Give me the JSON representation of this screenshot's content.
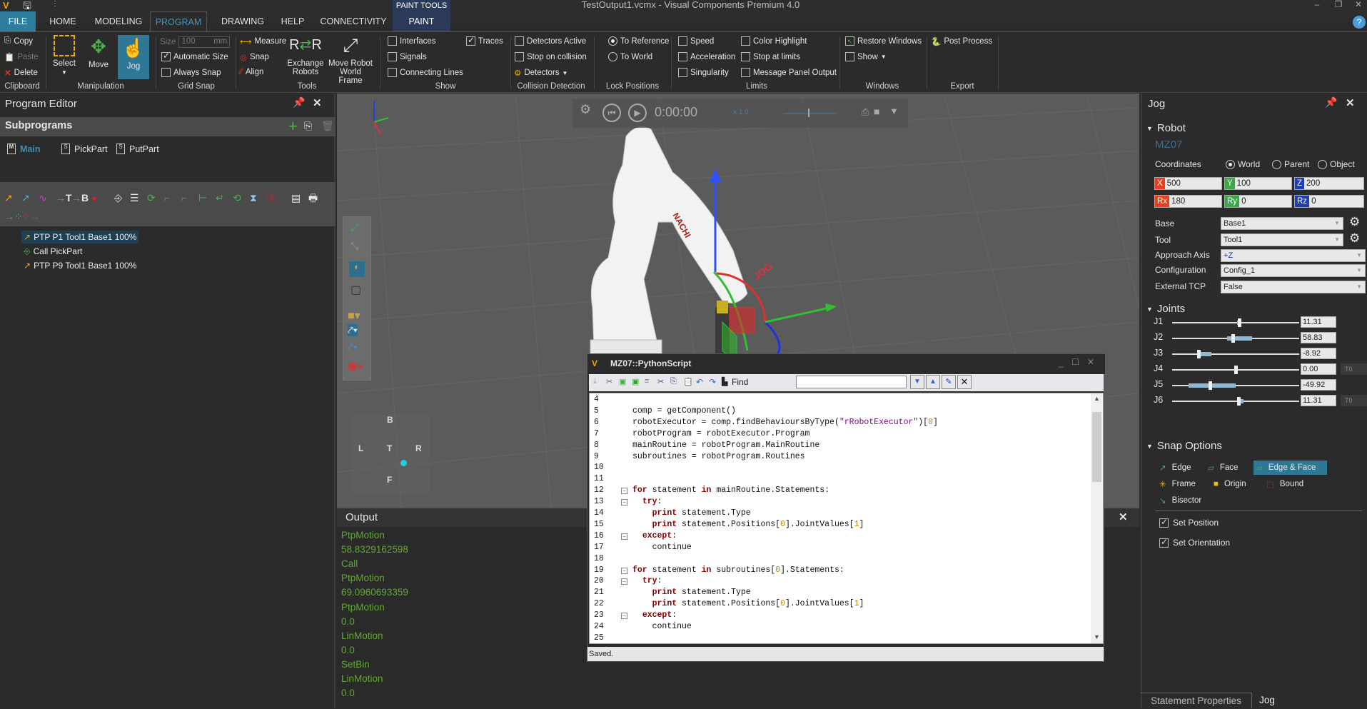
{
  "window": {
    "title": "TestOutput1.vcmx - Visual Components Premium 4.0",
    "quick_access": "⋮"
  },
  "tabs": {
    "context_group": "PAINT TOOLS",
    "items": [
      {
        "label": "FILE"
      },
      {
        "label": "HOME"
      },
      {
        "label": "MODELING"
      },
      {
        "label": "PROGRAM"
      },
      {
        "label": "DRAWING"
      },
      {
        "label": "HELP"
      },
      {
        "label": "CONNECTIVITY"
      },
      {
        "label": "PAINT"
      }
    ],
    "active": "PROGRAM"
  },
  "ribbon": {
    "clipboard": {
      "label": "Clipboard",
      "copy": "Copy",
      "paste": "Paste",
      "delete": "Delete"
    },
    "manipulation": {
      "label": "Manipulation",
      "select": "Select",
      "move": "Move",
      "jog": "Jog"
    },
    "grid_snap": {
      "label": "Grid Snap",
      "size_label": "Size",
      "size_value": "100",
      "size_unit": "mm",
      "automatic_size": "Automatic Size",
      "automatic_size_checked": true,
      "always_snap": "Always Snap",
      "always_snap_checked": false
    },
    "tools": {
      "label": "Tools",
      "measure": "Measure",
      "snap": "Snap",
      "align": "Align",
      "exchange_robots_1": "Exchange",
      "exchange_robots_2": "Robots",
      "move_robot_1": "Move Robot",
      "move_robot_2": "World Frame"
    },
    "show": {
      "label": "Show",
      "interfaces": "Interfaces",
      "signals": "Signals",
      "connecting_lines": "Connecting Lines",
      "traces": "Traces",
      "traces_checked": true
    },
    "collision": {
      "label": "Collision Detection",
      "detectors_active": "Detectors Active",
      "stop_on_collision": "Stop on collision",
      "detectors": "Detectors"
    },
    "lock_positions": {
      "label": "Lock Positions",
      "to_reference": "To Reference",
      "to_world": "To World",
      "selected": "To Reference"
    },
    "limits": {
      "label": "Limits",
      "speed": "Speed",
      "acceleration": "Acceleration",
      "singularity": "Singularity",
      "color_highlight": "Color Highlight",
      "stop_at_limits": "Stop at limits",
      "message_panel_output": "Message Panel Output"
    },
    "windows": {
      "label": "Windows",
      "restore_windows": "Restore Windows",
      "show": "Show"
    },
    "export": {
      "label": "Export",
      "post_process": "Post Process"
    }
  },
  "program_editor": {
    "title": "Program Editor",
    "subprograms_label": "Subprograms",
    "subprograms": [
      {
        "label": "Main",
        "icon": "M",
        "active": true
      },
      {
        "label": "PickPart",
        "icon": "S",
        "active": false
      },
      {
        "label": "PutPart",
        "icon": "S",
        "active": false
      }
    ],
    "statements": [
      {
        "label": "PTP P1 Tool1 Base1 100%",
        "type": "ptp",
        "selected": true
      },
      {
        "label": "Call PickPart",
        "type": "call",
        "selected": false
      },
      {
        "label": "PTP P9 Tool1 Base1 100%",
        "type": "ptp",
        "selected": false
      }
    ]
  },
  "viewport": {
    "sim_time": "0:00:00",
    "sim_speed": "x  1.0",
    "viewcube": {
      "back": "B",
      "left": "L",
      "top": "T",
      "right": "R",
      "front": "F"
    },
    "robot_brand": "NACHI",
    "jog_label": "JOG"
  },
  "output": {
    "title": "Output",
    "lines": [
      "PtpMotion",
      "58.8329162598",
      "Call",
      "PtpMotion",
      "69.0960693359",
      "PtpMotion",
      "0.0",
      "LinMotion",
      "0.0",
      "SetBin",
      "LinMotion",
      "0.0"
    ]
  },
  "script_editor": {
    "title": "MZ07::PythonScript",
    "find_label": "Find",
    "find_value": "",
    "status": "Saved.",
    "lines": [
      {
        "n": "4",
        "code": ""
      },
      {
        "n": "5",
        "code": "comp = getComponent()"
      },
      {
        "n": "6",
        "code": "robotExecutor = comp.findBehavioursByType(\"rRobotExecutor\")[0]"
      },
      {
        "n": "7",
        "code": "robotProgram = robotExecutor.Program"
      },
      {
        "n": "8",
        "code": "mainRoutine = robotProgram.MainRoutine"
      },
      {
        "n": "9",
        "code": "subroutines = robotProgram.Routines"
      },
      {
        "n": "10",
        "code": ""
      },
      {
        "n": "11",
        "code": ""
      },
      {
        "n": "12",
        "code": "for statement in mainRoutine.Statements:"
      },
      {
        "n": "13",
        "code": "  try:"
      },
      {
        "n": "14",
        "code": "    print statement.Type"
      },
      {
        "n": "15",
        "code": "    print statement.Positions[0].JointValues[1]"
      },
      {
        "n": "16",
        "code": "  except:"
      },
      {
        "n": "17",
        "code": "    continue"
      },
      {
        "n": "18",
        "code": ""
      },
      {
        "n": "19",
        "code": "for statement in subroutines[0].Statements:"
      },
      {
        "n": "20",
        "code": "  try:"
      },
      {
        "n": "21",
        "code": "    print statement.Type"
      },
      {
        "n": "22",
        "code": "    print statement.Positions[0].JointValues[1]"
      },
      {
        "n": "23",
        "code": "  except:"
      },
      {
        "n": "24",
        "code": "    continue"
      },
      {
        "n": "25",
        "code": ""
      }
    ]
  },
  "jog": {
    "title": "Jog",
    "robot_section": "Robot",
    "robot_name": "MZ07",
    "coordinates_label": "Coordinates",
    "coordinate_options": [
      "World",
      "Parent",
      "Object"
    ],
    "coordinate_selected": "World",
    "fields": [
      {
        "tag": "X",
        "value": "500",
        "color": "#e8401c"
      },
      {
        "tag": "Y",
        "value": "100",
        "color": "#3aa846"
      },
      {
        "tag": "Z",
        "value": "200",
        "color": "#1f3fb0"
      },
      {
        "tag": "Rx",
        "value": "180",
        "color": "#e8401c"
      },
      {
        "tag": "Ry",
        "value": "0",
        "color": "#3aa846"
      },
      {
        "tag": "Rz",
        "value": "0",
        "color": "#1f3fb0"
      }
    ],
    "base_label": "Base",
    "base_value": "Base1",
    "tool_label": "Tool",
    "tool_value": "Tool1",
    "approach_label": "Approach Axis",
    "approach_value": "+Z",
    "config_label": "Configuration",
    "config_value": "Config_1",
    "ext_tcp_label": "External TCP",
    "ext_tcp_value": "False",
    "joints_section": "Joints",
    "joints": [
      {
        "name": "J1",
        "value": "11.31",
        "pos": 0.53,
        "range": [
          0.51,
          0.53
        ],
        "turn": ""
      },
      {
        "name": "J2",
        "value": "58.83",
        "pos": 0.48,
        "range": [
          0.43,
          0.63
        ],
        "turn": ""
      },
      {
        "name": "J3",
        "value": "-8.92",
        "pos": 0.21,
        "range": [
          0.21,
          0.31
        ],
        "turn": ""
      },
      {
        "name": "J4",
        "value": "0.00",
        "pos": 0.5,
        "range": [
          0.5,
          0.5
        ],
        "turn": "T0"
      },
      {
        "name": "J5",
        "value": "-49.92",
        "pos": 0.3,
        "range": [
          0.13,
          0.5
        ],
        "turn": ""
      },
      {
        "name": "J6",
        "value": "11.31",
        "pos": 0.52,
        "range": [
          0.52,
          0.56
        ],
        "turn": "T0"
      }
    ],
    "snap_section": "Snap Options",
    "snap_options": [
      {
        "label": "Edge",
        "selected": false
      },
      {
        "label": "Face",
        "selected": false
      },
      {
        "label": "Edge & Face",
        "selected": true
      },
      {
        "label": "Frame",
        "selected": false
      },
      {
        "label": "Origin",
        "selected": false
      },
      {
        "label": "Bound",
        "selected": false
      },
      {
        "label": "Bisector",
        "selected": false
      }
    ],
    "set_position": "Set Position",
    "set_position_checked": true,
    "set_orientation": "Set Orientation",
    "set_orientation_checked": true
  },
  "bottom_tabs": [
    {
      "label": "Statement Properties",
      "active": false
    },
    {
      "label": "Jog",
      "active": true
    }
  ]
}
